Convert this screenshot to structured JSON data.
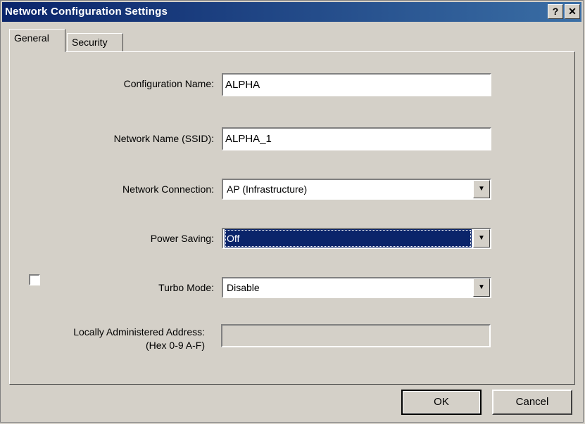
{
  "window": {
    "title": "Network Configuration Settings",
    "help_glyph": "?",
    "close_glyph": "✕"
  },
  "tabs": [
    {
      "label": "General",
      "active": true
    },
    {
      "label": "Security",
      "active": false
    }
  ],
  "form": {
    "config_name": {
      "label": "Configuration Name:",
      "value": "ALPHA"
    },
    "ssid": {
      "label": "Network Name (SSID):",
      "value": "ALPHA_1"
    },
    "network_connection": {
      "label": "Network Connection:",
      "value": "AP (Infrastructure)"
    },
    "power_saving": {
      "label": "Power Saving:",
      "value": "Off"
    },
    "turbo_mode": {
      "label": "Turbo Mode:",
      "value": "Disable"
    },
    "laa": {
      "label": "Locally Administered Address:",
      "hint": "(Hex 0-9 A-F)",
      "checked": false,
      "value": ""
    }
  },
  "buttons": {
    "ok": "OK",
    "cancel": "Cancel"
  },
  "icons": {
    "dropdown": "▼"
  }
}
